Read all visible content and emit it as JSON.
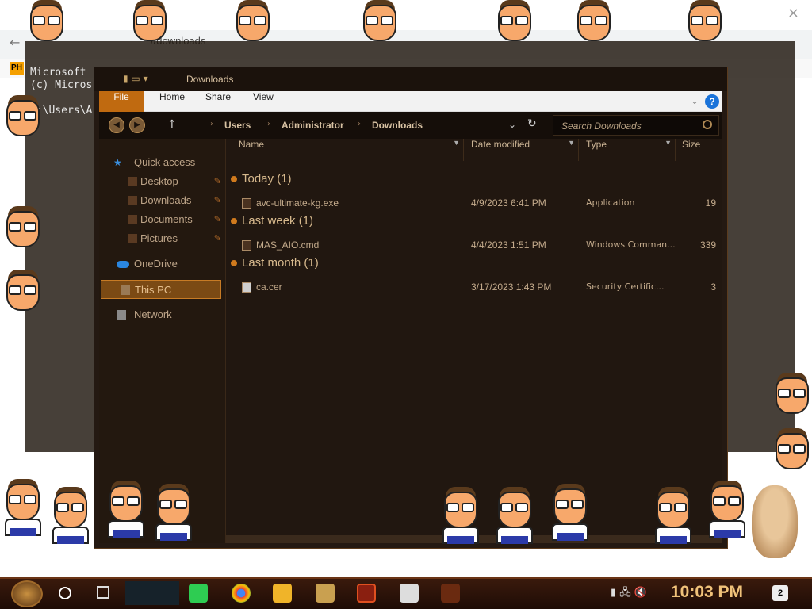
{
  "browser": {
    "url_fragment": "//downloads",
    "back_icon": "arrow-left-icon",
    "close_glyph": "×"
  },
  "console": {
    "lines": [
      "Microsoft",
      "(c) Micros",
      "",
      "C:\\Users\\A"
    ]
  },
  "explorer": {
    "title": "Downloads",
    "ribbon": {
      "file": "File",
      "home": "Home",
      "share": "Share",
      "view": "View",
      "help": "?"
    },
    "breadcrumb": [
      "Users",
      "Administrator",
      "Downloads"
    ],
    "search_placeholder": "Search Downloads",
    "nav": {
      "quick_access": "Quick access",
      "desktop": "Desktop",
      "downloads": "Downloads",
      "documents": "Documents",
      "pictures": "Pictures",
      "onedrive": "OneDrive",
      "this_pc": "This PC",
      "network": "Network"
    },
    "columns": {
      "name": "Name",
      "date": "Date modified",
      "type": "Type",
      "size": "Size"
    },
    "groups": [
      {
        "label": "Today (1)",
        "file": {
          "name": "avc-ultimate-kg.exe",
          "date": "4/9/2023 6:41 PM",
          "type": "Application",
          "size": "19"
        }
      },
      {
        "label": "Last week (1)",
        "file": {
          "name": "MAS_AIO.cmd",
          "date": "4/4/2023 1:51 PM",
          "type": "Windows Comman...",
          "size": "339"
        }
      },
      {
        "label": "Last month (1)",
        "file": {
          "name": "ca.cer",
          "date": "3/17/2023 1:43 PM",
          "type": "Security Certific...",
          "size": "3"
        }
      }
    ]
  },
  "taskbar": {
    "clock": "10:03 PM",
    "notifications": "2",
    "accent": "#f0c27a"
  }
}
